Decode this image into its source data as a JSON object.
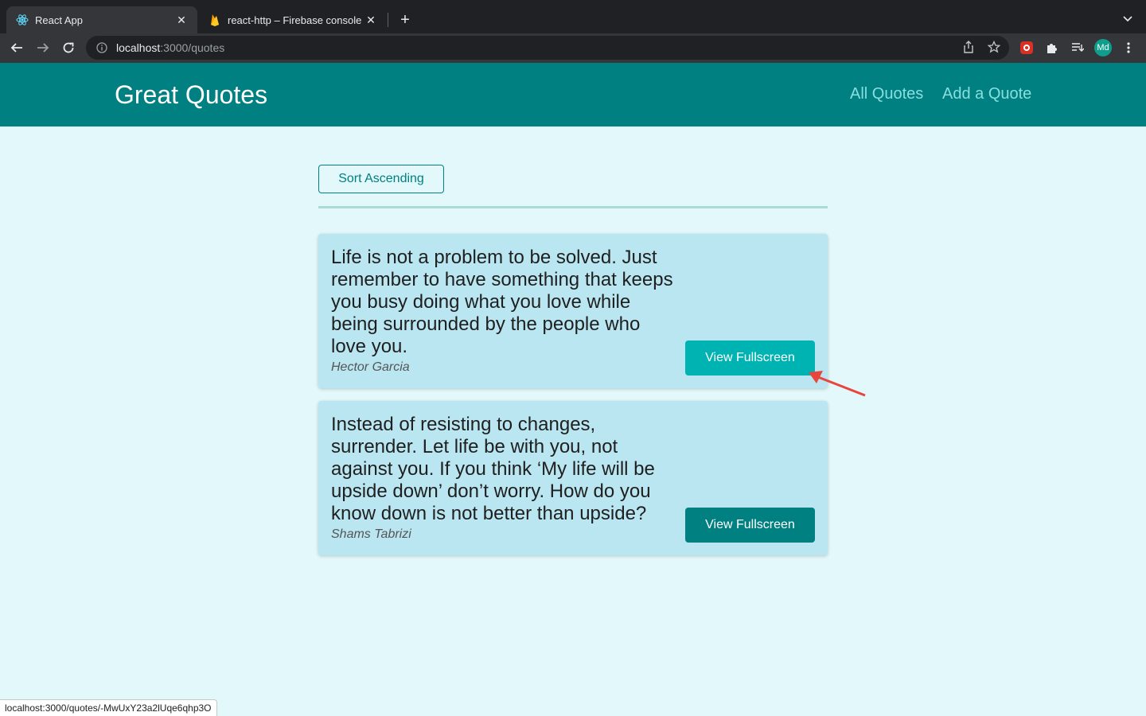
{
  "browser": {
    "tabs": [
      {
        "title": "React App",
        "icon": "react-icon",
        "active": true
      },
      {
        "title": "react-http – Firebase console",
        "icon": "firebase-icon",
        "active": false
      }
    ],
    "url_host": "localhost",
    "url_path": ":3000/quotes",
    "profile_initials": "Md",
    "status_url": "localhost:3000/quotes/-MwUxY23a2lUqe6qhp3O"
  },
  "header": {
    "brand": "Great Quotes",
    "nav": [
      "All Quotes",
      "Add a Quote"
    ]
  },
  "main": {
    "sort_label": "Sort Ascending",
    "quotes": [
      {
        "text": "Life is not a problem to be solved. Just remember to have something that keeps you busy doing what you love while being surrounded by the people who love you.",
        "author": "Hector Garcia",
        "button": "View Fullscreen"
      },
      {
        "text": "Instead of resisting to changes, surrender. Let life be with you, not against you. If you think ‘My life will be upside down’ don’t worry. How do you know down is not better than upside?",
        "author": "Shams Tabrizi",
        "button": "View Fullscreen"
      }
    ]
  },
  "colors": {
    "header_bg": "#008080",
    "page_bg": "#e2f8fb",
    "card_bg": "#b9e6f1",
    "button_hover": "#00b3b3",
    "button": "#008080",
    "annotation_arrow": "#e8453c"
  }
}
